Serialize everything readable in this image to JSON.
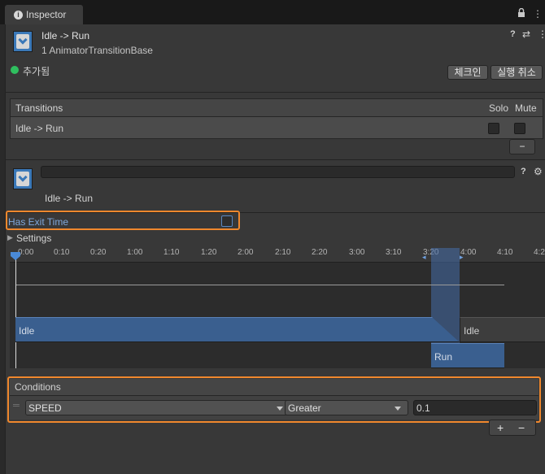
{
  "window": {
    "tab_title": "Inspector",
    "tab_icon": "info-icon",
    "lock_icon": "lock-icon",
    "menu_icon": "kebab-menu-icon"
  },
  "header": {
    "title": "Idle -> Run",
    "subtitle": "1 AnimatorTransitionBase",
    "add_label": "추가됨",
    "checkin_label": "체크인",
    "undo_label": "실행 취소"
  },
  "transitions": {
    "header": "Transitions",
    "solo": "Solo",
    "mute": "Mute",
    "rows": [
      {
        "name": "Idle -> Run",
        "solo": false,
        "mute": false
      }
    ],
    "remove_label": "−"
  },
  "transition": {
    "name_field": "",
    "label": "Idle -> Run",
    "has_exit_time_label": "Has Exit Time",
    "has_exit_time": false,
    "settings_label": "Settings"
  },
  "timeline": {
    "ticks": [
      "0:00",
      "0:10",
      "0:20",
      "1:00",
      "1:10",
      "1:20",
      "2:00",
      "2:10",
      "2:20",
      "3:00",
      "3:10",
      "3:20",
      "4:00",
      "4:10",
      "4:2"
    ],
    "source_state": "Idle",
    "dest_state_right": "Idle",
    "dest_state": "Run"
  },
  "conditions": {
    "header": "Conditions",
    "rows": [
      {
        "parameter": "SPEED",
        "mode": "Greater",
        "threshold": "0.1"
      }
    ],
    "add_label": "+",
    "remove_label": "−"
  },
  "colors": {
    "accent_blue": "#3a5f8f",
    "highlight_orange": "#f0882d",
    "panel_bg": "#383838"
  }
}
